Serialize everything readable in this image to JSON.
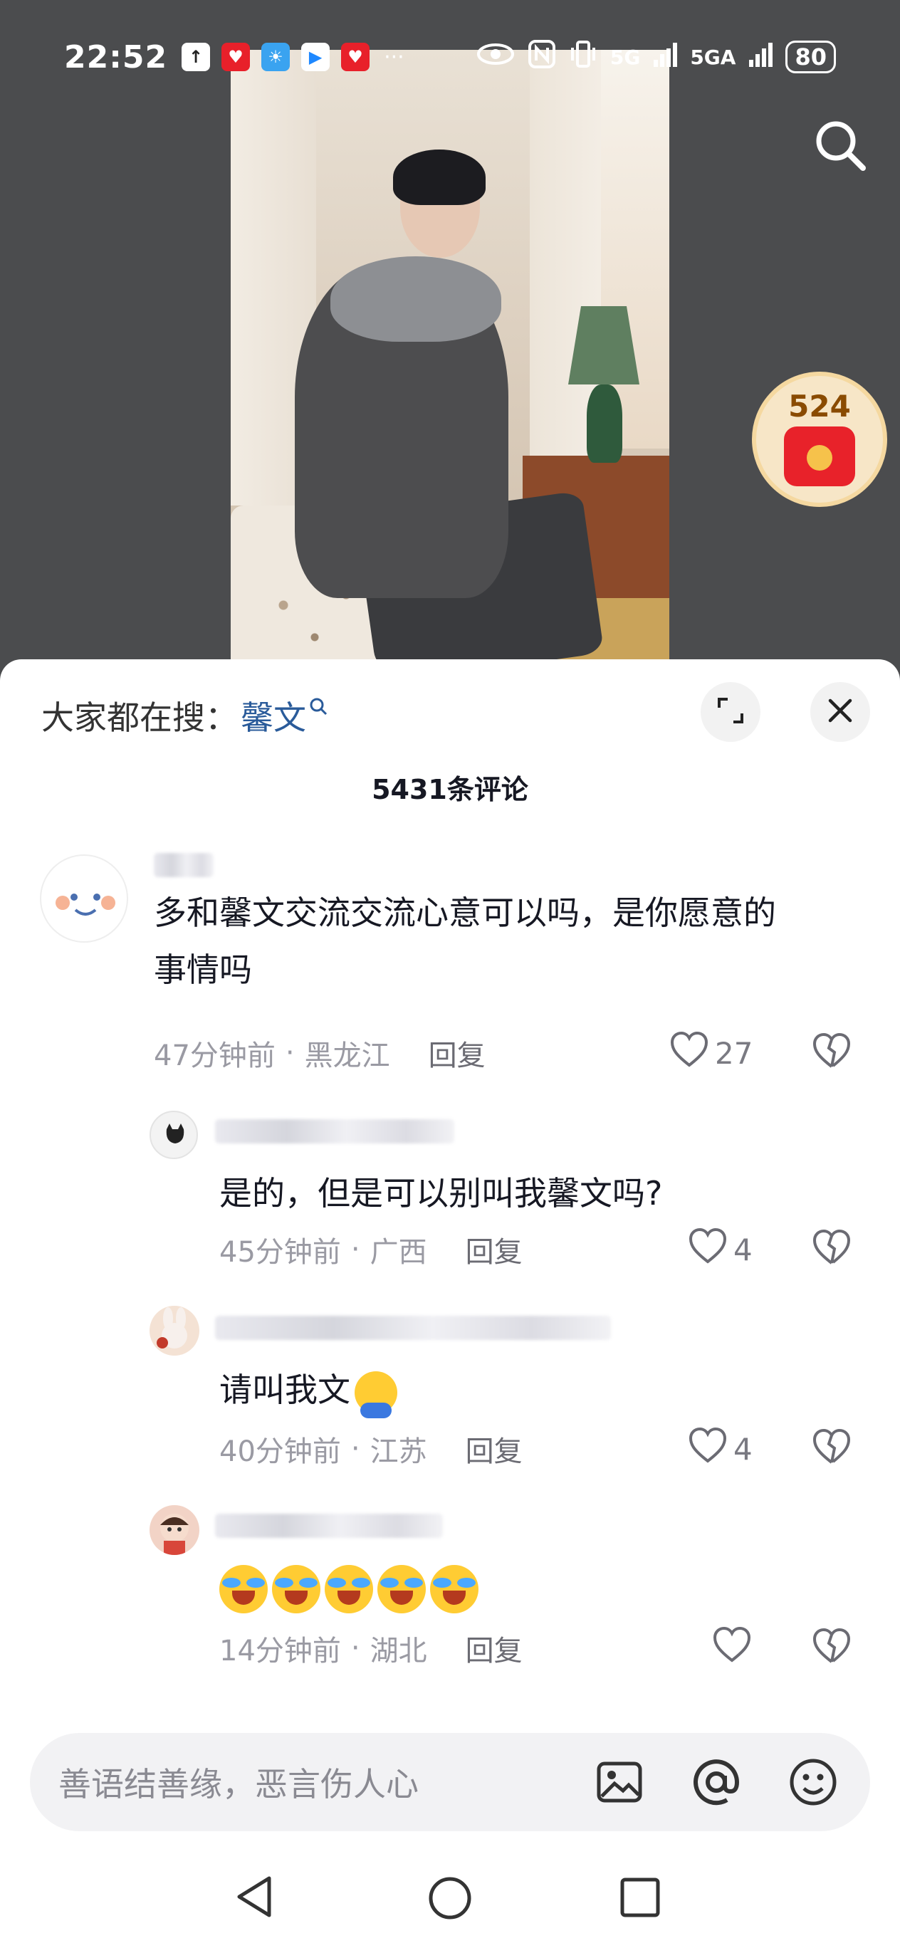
{
  "status_bar": {
    "time": "22:52",
    "more": "···",
    "network_1": "5G",
    "network_2": "5GA",
    "battery": "80"
  },
  "video": {
    "red_packet_count": "524"
  },
  "sheet": {
    "hot_search_label": "大家都在搜：",
    "hot_search_term": "馨文",
    "comment_count": "5431条评论"
  },
  "comments": [
    {
      "text_line1": "多和馨文交流交流心意可以吗，是你愿意的",
      "text_line2": "事情吗",
      "time": "47分钟前",
      "location": "黑龙江",
      "reply": "回复",
      "likes": "27"
    },
    {
      "text": "是的，但是可以别叫我馨文吗?",
      "time": "45分钟前",
      "location": "广西",
      "reply": "回复",
      "likes": "4"
    },
    {
      "text": "请叫我文",
      "time": "40分钟前",
      "location": "江苏",
      "reply": "回复",
      "likes": "4"
    },
    {
      "time": "14分钟前",
      "location": "湖北",
      "reply": "回复"
    }
  ],
  "meta_sep": "·",
  "input": {
    "placeholder": "善语结善缘，恶言伤人心"
  },
  "colors": {
    "accent_link": "#2a5b9a",
    "red_packet": "#e8222a"
  }
}
